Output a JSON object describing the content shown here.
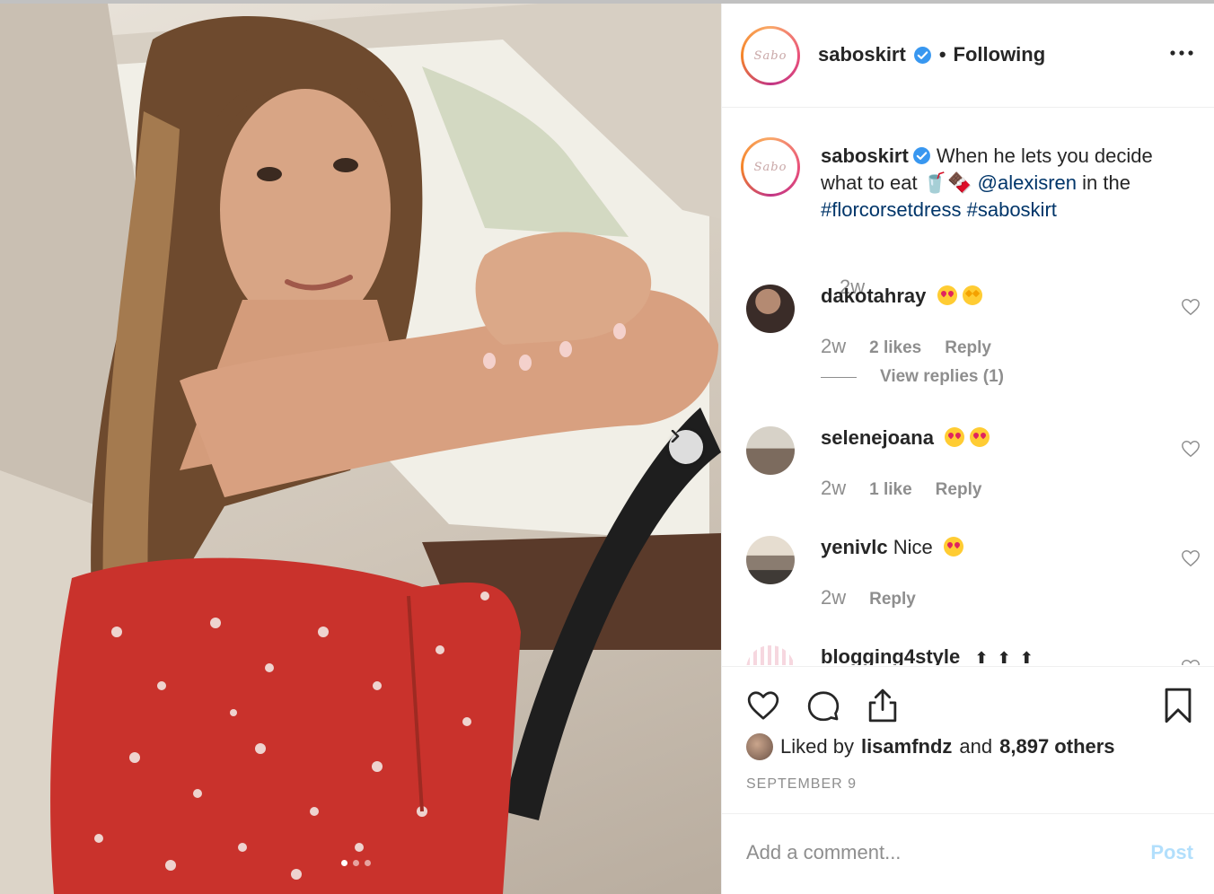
{
  "post": {
    "username": "saboskirt",
    "follow_state": "Following",
    "separator": "•",
    "avatar_text": "Sabo"
  },
  "caption": {
    "username": "saboskirt",
    "text_before": "When he lets you decide what to eat 🥤🍫",
    "mention": "@alexisren",
    "text_after": "in the",
    "hashtags": "#florcorsetdress #saboskirt",
    "time": "2w"
  },
  "comments": [
    {
      "username": "dakotahray",
      "text": "",
      "time": "2w",
      "likes": "2 likes",
      "reply": "Reply",
      "view_replies": "View replies (1)"
    },
    {
      "username": "selenejoana",
      "text": "",
      "time": "2w",
      "likes": "1 like",
      "reply": "Reply"
    },
    {
      "username": "yenivlc",
      "text": "Nice",
      "time": "2w",
      "reply": "Reply"
    },
    {
      "username": "blogging4style",
      "text": ""
    }
  ],
  "likes": {
    "prefix": "Liked by",
    "user": "lisamfndz",
    "conjunction": "and",
    "others": "8,897 others"
  },
  "date": "SEPTEMBER 9",
  "composer": {
    "placeholder": "Add a comment...",
    "post_label": "Post"
  },
  "colors": {
    "text": "#262626",
    "muted": "#8e8e8e",
    "link": "#003569",
    "post_disabled": "#b2dffc",
    "verified": "#3897f0"
  },
  "icons": [
    "chevron-right-icon",
    "more-icon",
    "heart-icon",
    "comment-icon",
    "share-icon",
    "bookmark-icon",
    "verified-icon"
  ]
}
